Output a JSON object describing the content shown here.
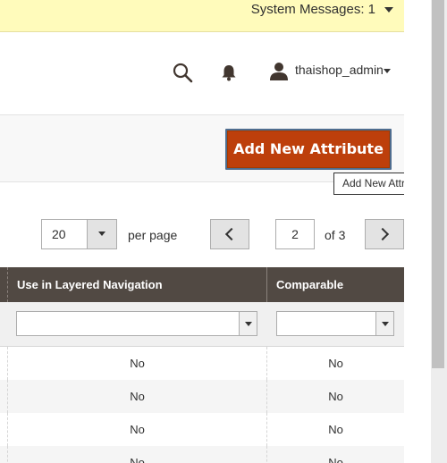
{
  "system_messages": {
    "label": "System Messages: 1"
  },
  "header": {
    "username": "thaishop_admin"
  },
  "page_actions": {
    "add_button": "Add New Attribute",
    "tooltip": "Add New Attribute"
  },
  "pagination": {
    "per_page_value": "20",
    "per_page_label": "per page",
    "current_page": "2",
    "of_pages": "of 3"
  },
  "grid": {
    "columns": [
      "Use in Layered Navigation",
      "Comparable"
    ],
    "rows": [
      [
        "No",
        "No"
      ],
      [
        "No",
        "No"
      ],
      [
        "No",
        "No"
      ],
      [
        "No",
        "No"
      ]
    ]
  },
  "colors": {
    "accent_button": "#bd3f0b",
    "grid_header": "#514943",
    "system_bar": "#fffbbb"
  },
  "icons": [
    "search-icon",
    "bell-icon",
    "user-icon",
    "chevron-left-icon",
    "chevron-right-icon",
    "caret-down-icon"
  ]
}
